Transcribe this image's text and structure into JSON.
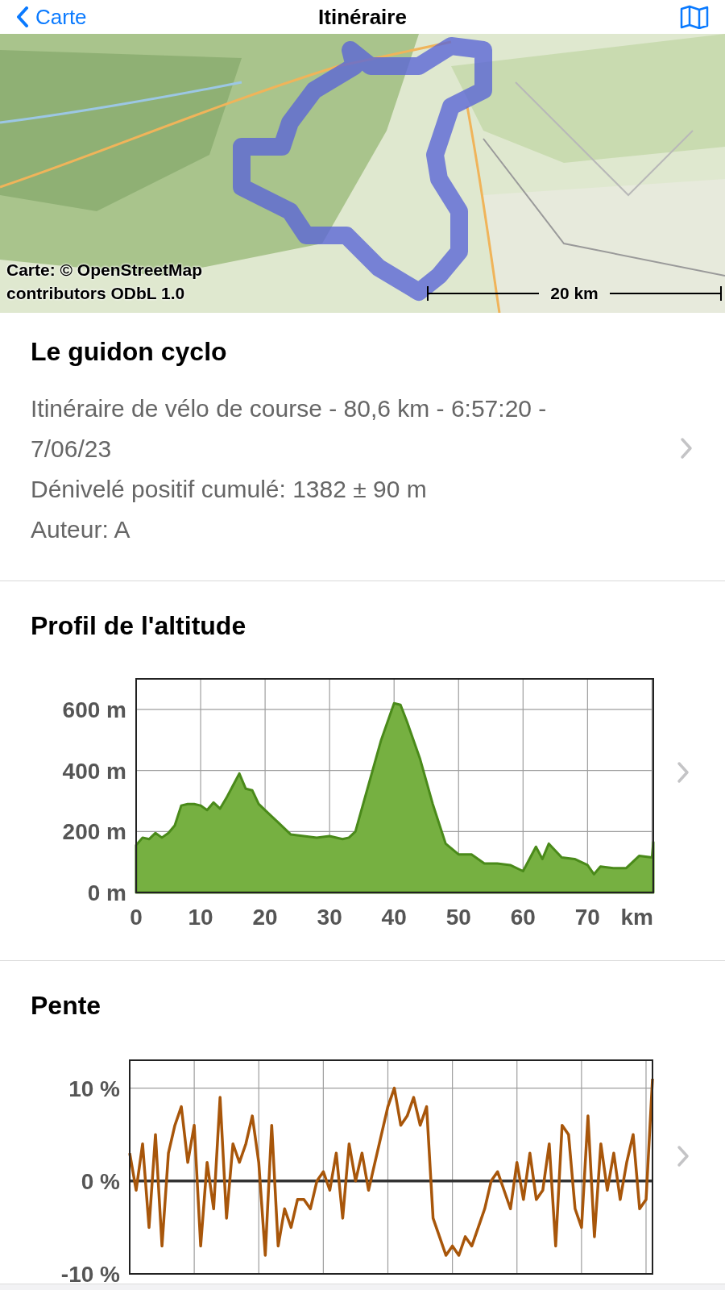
{
  "nav": {
    "back_label": "Carte",
    "title": "Itinéraire"
  },
  "map": {
    "kind": "picture",
    "attribution": "Carte: © OpenStreetMap contributors ODbL 1.0",
    "scale": "20 km"
  },
  "route": {
    "name": "Le guidon cyclo",
    "details": [
      "Itinéraire de vélo de course - 80,6 km - 6:57:20 - 7/06/23",
      "Dénivelé positif cumulé: 1382 ± 90 m",
      "Auteur: A"
    ]
  },
  "sections": [
    {
      "title": "Profil de l'altitude",
      "chart_data": {
        "type": "area",
        "xlabel": "km",
        "grid": true,
        "xlim": [
          0,
          80.2
        ],
        "ylim": [
          0,
          700
        ],
        "xticks": [
          {
            "value": 0,
            "label": "0"
          },
          {
            "value": 10,
            "label": "10"
          },
          {
            "value": 20,
            "label": "20"
          },
          {
            "value": 30,
            "label": "30"
          },
          {
            "value": 40,
            "label": "40"
          },
          {
            "value": 50,
            "label": "50"
          },
          {
            "value": 60,
            "label": "60"
          },
          {
            "value": 70,
            "label": "70"
          }
        ],
        "yticks": [
          {
            "value": 0,
            "label": "0 m"
          },
          {
            "value": 200,
            "label": "200 m"
          },
          {
            "value": 400,
            "label": "400 m"
          },
          {
            "value": 600,
            "label": "600 m"
          }
        ],
        "x": [
          0,
          1,
          2,
          3,
          4,
          5,
          6,
          7,
          8,
          9,
          10,
          11,
          12,
          13,
          14,
          15,
          16,
          17,
          18,
          19,
          20,
          22,
          24,
          26,
          28,
          30,
          32,
          33,
          34,
          36,
          38,
          40,
          41,
          42,
          44,
          46,
          48,
          50,
          52,
          54,
          56,
          58,
          60,
          62,
          63,
          64,
          66,
          68,
          70,
          71,
          72,
          74,
          76,
          78,
          80,
          80.2
        ],
        "values": [
          155,
          180,
          175,
          195,
          180,
          195,
          220,
          285,
          290,
          290,
          285,
          270,
          295,
          275,
          310,
          350,
          390,
          340,
          335,
          290,
          270,
          230,
          190,
          185,
          180,
          185,
          175,
          180,
          200,
          350,
          500,
          620,
          615,
          560,
          440,
          290,
          160,
          125,
          125,
          95,
          95,
          90,
          70,
          150,
          110,
          160,
          115,
          110,
          90,
          60,
          85,
          80,
          80,
          120,
          115,
          165
        ]
      }
    },
    {
      "title": "Pente",
      "chart_data": {
        "type": "line",
        "grid": true,
        "ylim": [
          -10,
          13
        ],
        "yticks": [
          {
            "value": -10,
            "label": "-10 %"
          },
          {
            "value": 0,
            "label": "0 %"
          },
          {
            "value": 10,
            "label": "10 %"
          }
        ],
        "categories": [
          null,
          null,
          null,
          null,
          null,
          null,
          null,
          null,
          null,
          null,
          null,
          null,
          null,
          null,
          null,
          null,
          null,
          null,
          null,
          null,
          null,
          null,
          null,
          null,
          null,
          null,
          null,
          null,
          null,
          null,
          null,
          null,
          null,
          null,
          null,
          null,
          null,
          null,
          null,
          null,
          null,
          null,
          null,
          null,
          null,
          null,
          null,
          null,
          null,
          null,
          null,
          null,
          null,
          null,
          null,
          null,
          null,
          null,
          null,
          null,
          null,
          null,
          null,
          null,
          null,
          null,
          null,
          null,
          null,
          null,
          null,
          null,
          null,
          null,
          null,
          null,
          null,
          null,
          null,
          null,
          null,
          null
        ],
        "series": [
          {
            "color": "#a8560a",
            "values": [
              3,
              -1,
              4,
              -5,
              5,
              -7,
              3,
              6,
              8,
              2,
              6,
              -7,
              2,
              -3,
              9,
              -4,
              4,
              2,
              4,
              7,
              2,
              -8,
              6,
              -7,
              -3,
              -5,
              -2,
              -2,
              -3,
              0,
              1,
              -1,
              3,
              -4,
              4,
              0,
              3,
              -1,
              2,
              5,
              8,
              10,
              6,
              7,
              9,
              6,
              8,
              -4,
              -6,
              -8,
              -7,
              -8,
              -6,
              -7,
              -5,
              -3,
              0,
              1,
              -1,
              -3,
              2,
              -2,
              3,
              -2,
              -1,
              4,
              -7,
              6,
              5,
              -3,
              -5,
              7,
              -6,
              4,
              -1,
              3,
              -2,
              2,
              5,
              -3,
              -2,
              11
            ]
          }
        ]
      }
    }
  ]
}
